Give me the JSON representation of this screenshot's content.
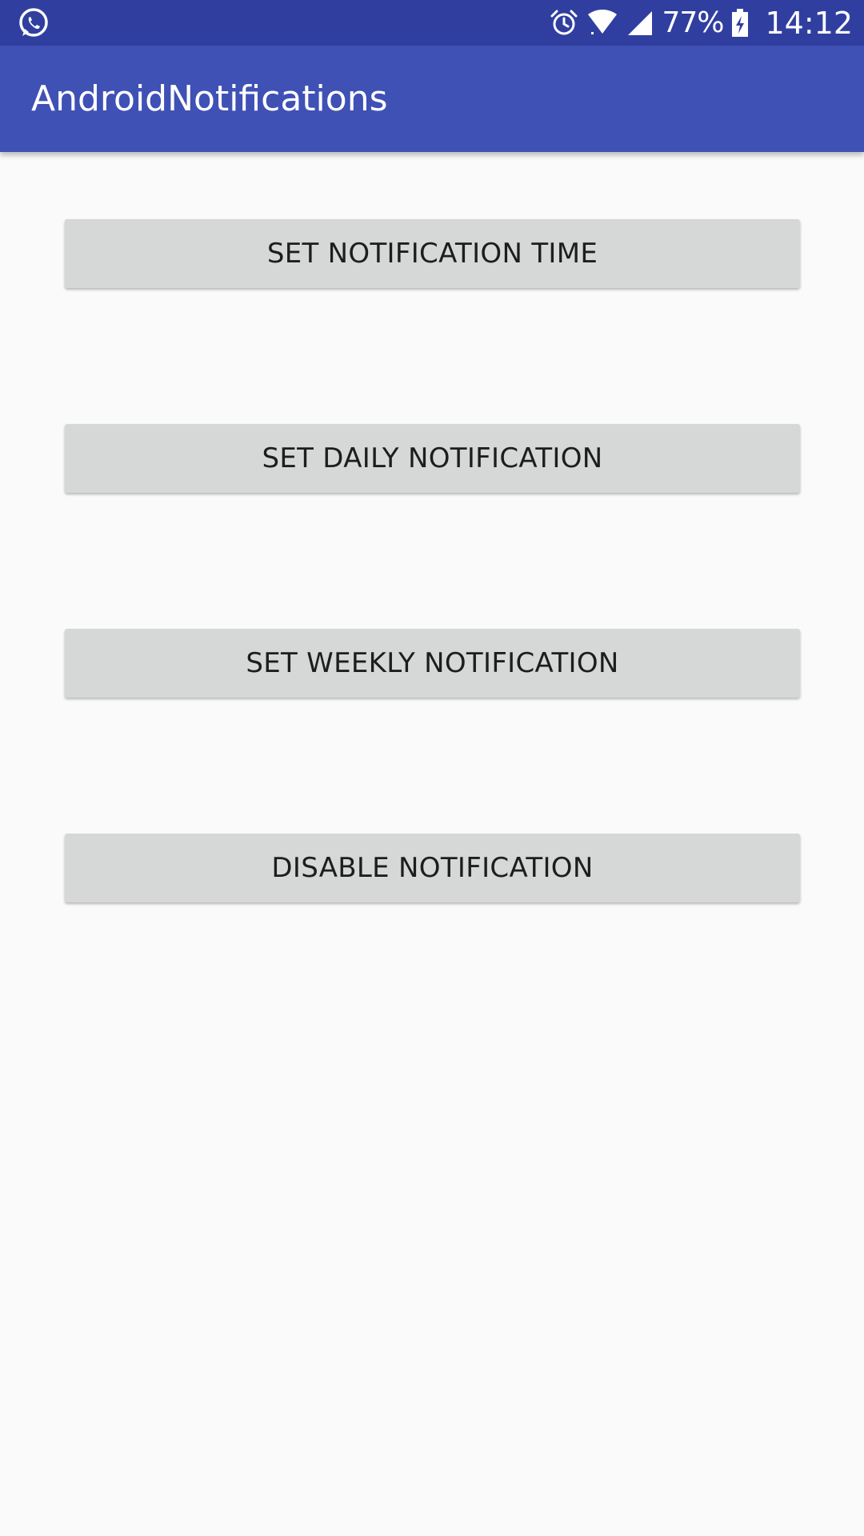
{
  "status_bar": {
    "left_icon": "whatsapp-icon",
    "icons": [
      "alarm-clock-icon",
      "wifi-icon",
      "cell-signal-icon"
    ],
    "battery_percent": "77%",
    "battery_icon": "battery-charging-icon",
    "time": "14:12"
  },
  "app_bar": {
    "title": "AndroidNotifications"
  },
  "buttons": {
    "set_time": "SET NOTIFICATION TIME",
    "set_daily": "SET DAILY NOTIFICATION",
    "set_weekly": "SET WEEKLY NOTIFICATION",
    "disable": "DISABLE NOTIFICATION"
  },
  "colors": {
    "status_bar": "#303f9f",
    "app_bar": "#3f51b5",
    "button_bg": "#d6d7d7",
    "background": "#fafafa"
  }
}
